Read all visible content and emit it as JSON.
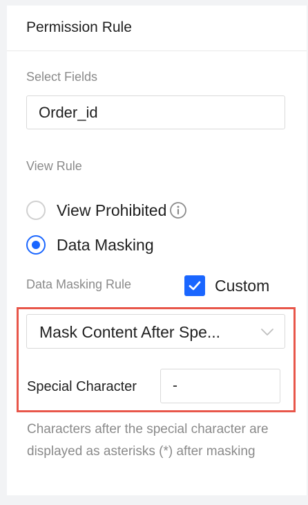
{
  "panel": {
    "title": "Permission Rule"
  },
  "select_fields": {
    "label": "Select Fields",
    "value": "Order_id"
  },
  "view_rule": {
    "label": "View Rule",
    "options": [
      {
        "label": "View Prohibited",
        "selected": false,
        "has_info_icon": true
      },
      {
        "label": "Data Masking",
        "selected": true
      }
    ]
  },
  "masking_rule": {
    "label": "Data Masking Rule",
    "custom_checkbox": {
      "label": "Custom",
      "checked": true
    },
    "select": {
      "value": "Mask Content After Spe..."
    },
    "special_character": {
      "label": "Special Character",
      "value": "-"
    },
    "hint": "Characters after the special character are displayed as asterisks (*) after masking"
  },
  "colors": {
    "accent": "#1a66ff",
    "highlight_border": "#e8564a",
    "muted_text": "#8a8a8a"
  },
  "icons": {
    "info": "info-circle-icon",
    "check": "check-icon",
    "dropdown": "chevron-down-icon"
  }
}
